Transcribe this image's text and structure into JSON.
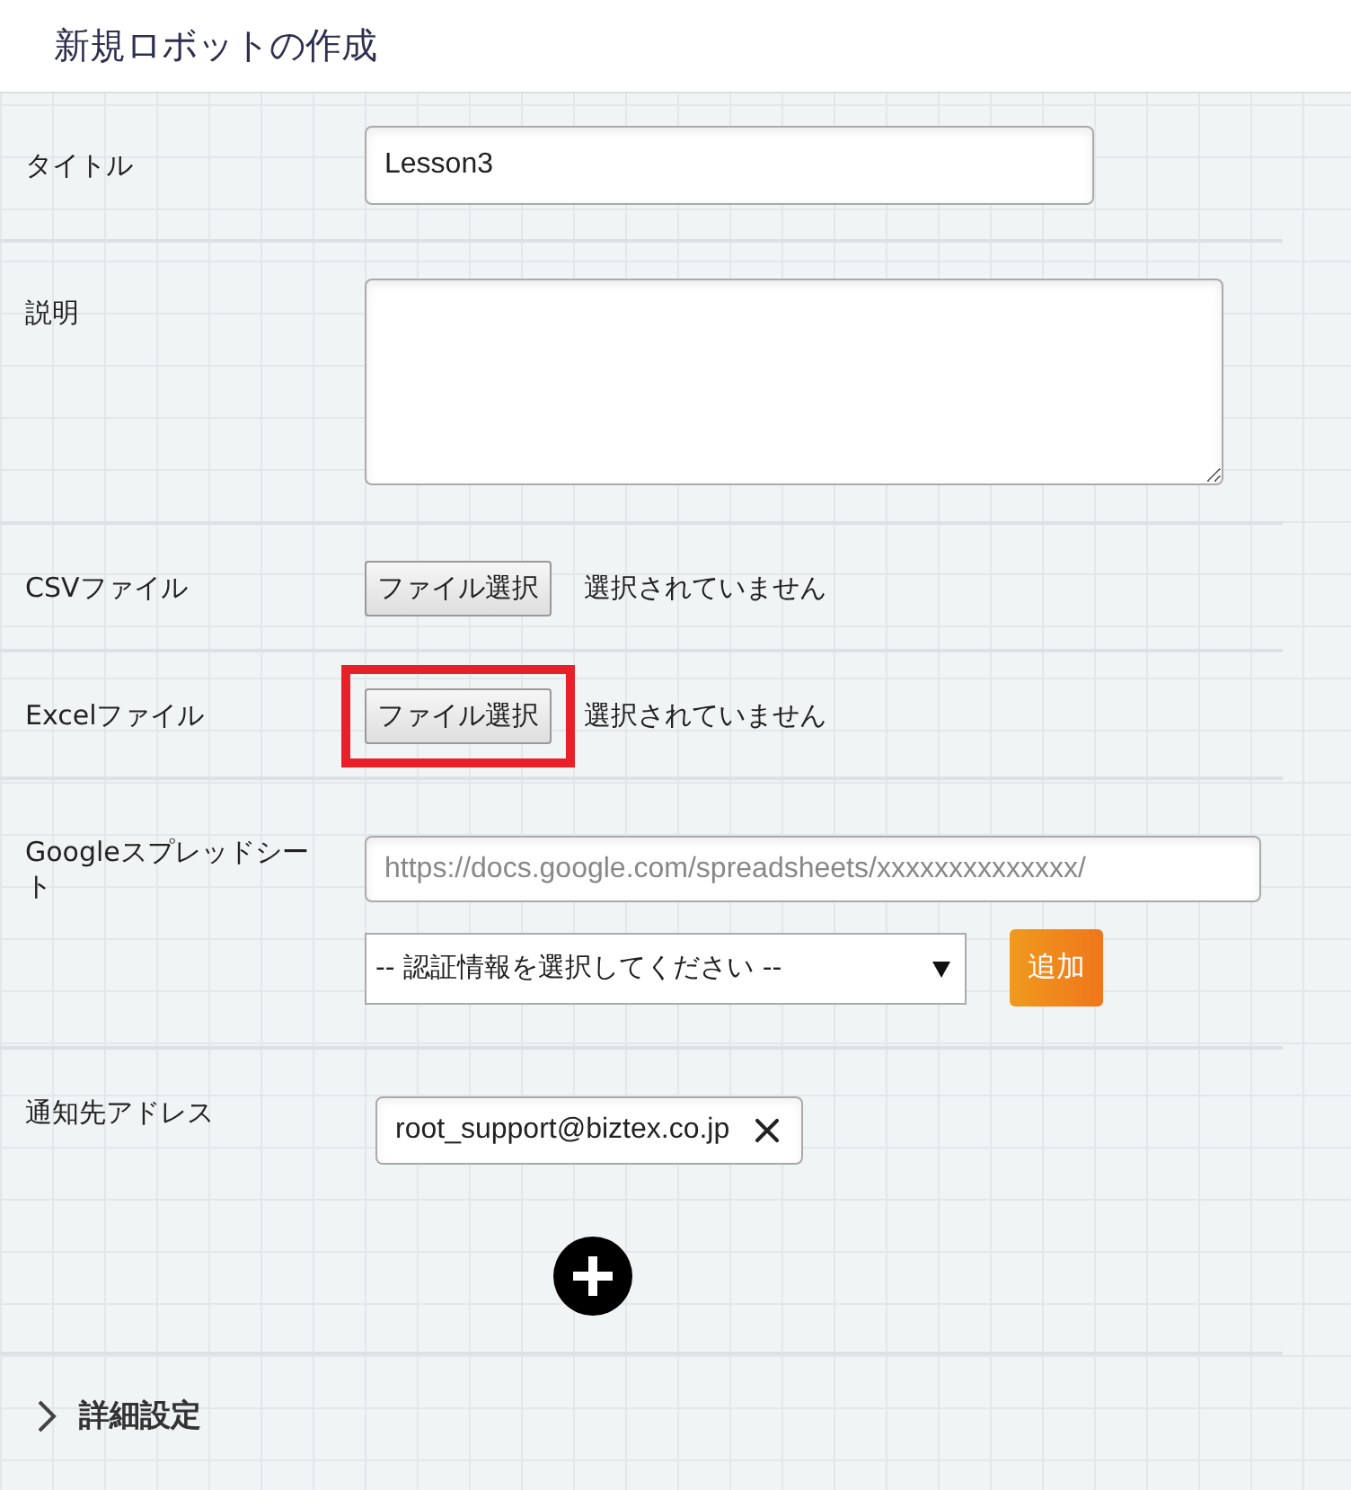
{
  "header": {
    "title": "新規ロボットの作成"
  },
  "rows": [
    {
      "kind": "text",
      "label": "タイトル",
      "value": "Lesson3"
    },
    {
      "kind": "textarea",
      "label": "説明"
    },
    {
      "kind": "file",
      "label": "CSVファイル",
      "button": "ファイル選択",
      "status": "選択されていません",
      "highlighted": false
    },
    {
      "kind": "file",
      "label": "Excelファイル",
      "button": "ファイル選択",
      "status": "選択されていません",
      "highlighted": true
    },
    {
      "kind": "google",
      "label": "Googleスプレッドシート",
      "placeholder": "https://docs.google.com/spreadsheets/xxxxxxxxxxxxxx/",
      "select": "-- 認証情報を選択してください --",
      "button": "追加"
    },
    {
      "kind": "emails",
      "label": "通知先アドレス",
      "emails": [
        "root_support@biztex.co.jp"
      ]
    }
  ],
  "details": {
    "label": "詳細設定",
    "expanded": false
  }
}
